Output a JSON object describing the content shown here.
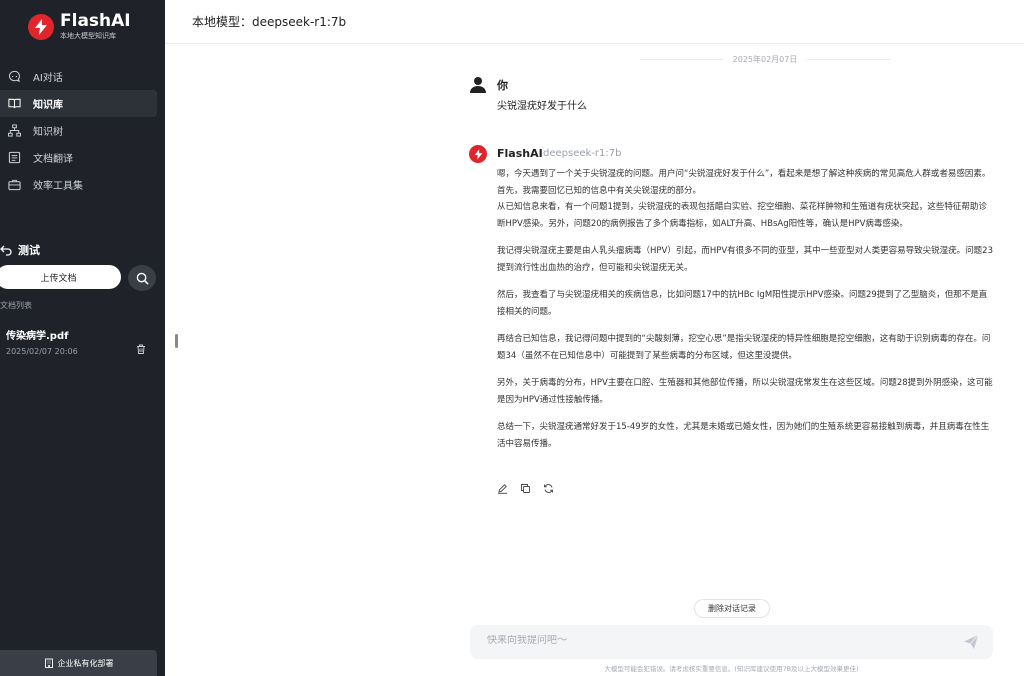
{
  "brand": {
    "name": "FlashAI",
    "subtitle": "本地大模型知识库"
  },
  "nav": [
    {
      "label": "AI对话",
      "icon": "chat-icon",
      "active": false
    },
    {
      "label": "知识库",
      "icon": "book-icon",
      "active": true
    },
    {
      "label": "知识树",
      "icon": "tree-icon",
      "active": false
    },
    {
      "label": "文档翻译",
      "icon": "document-icon",
      "active": false
    },
    {
      "label": "效率工具集",
      "icon": "toolbox-icon",
      "active": false
    }
  ],
  "knowledge_base": {
    "name": "测试",
    "upload_label": "上传文档",
    "doc_list_label": "文档列表",
    "documents": [
      {
        "name": "传染病学.pdf",
        "date": "2025/02/07 20:06"
      }
    ]
  },
  "enterprise_label": "企业私有化部署",
  "header": {
    "label": "本地模型：deepseek-r1:7b"
  },
  "chat": {
    "date": "2025年02月07日",
    "user_name": "你",
    "user_message": "尖锐湿疣好发于什么",
    "ai_name": "FlashAI",
    "ai_model": "deepseek-r1:7b",
    "ai_paragraphs": [
      "嗯，今天遇到了一个关于尖锐湿疣的问题。用户问“尖锐湿疣好发于什么”，看起来是想了解这种疾病的常见高危人群或者易感因素。首先，我需要回忆已知的信息中有关尖锐湿疣的部分。",
      "从已知信息来看，有一个问题1提到，尖锐湿疣的表现包括醋白实验、挖空细胞、菜花样肿物和生殖道有疣状突起，这些特征帮助诊断HPV感染。另外，问题20的病例报告了多个病毒指标，如ALT升高、HBsAg阳性等，确认是HPV病毒感染。",
      "我记得尖锐湿疣主要是由人乳头瘤病毒（HPV）引起，而HPV有很多不同的亚型，其中一些亚型对人类更容易导致尖锐湿疣。问题23提到流行性出血热的治疗，但可能和尖锐湿疣无关。",
      "然后，我查看了与尖锐湿疣相关的疾病信息，比如问题17中的抗HBc IgM阳性提示HPV感染。问题29提到了乙型脑炎，但那不是直接相关的问题。",
      "再结合已知信息，我记得问题中提到的“尖酸刻薄，挖空心思”是指尖锐湿疣的特异性细胞是挖空细胞，这有助于识别病毒的存在。问题34（虽然不在已知信息中）可能提到了某些病毒的分布区域，但这里没提供。",
      "另外，关于病毒的分布，HPV主要在口腔、生殖器和其他部位传播，所以尖锐湿疣常发生在这些区域。问题28提到外阴感染，这可能是因为HPV通过性接触传播。",
      "总结一下，尖锐湿疣通常好发于15-49岁的女性，尤其是未婚或已婚女性，因为她们的生殖系统更容易接触到病毒，并且病毒在性生活中容易传播。"
    ],
    "clear_label": "删除对话记录",
    "input_placeholder": "快来向我提问吧～",
    "disclaimer": "大模型可能会犯错误。请考虑核实重要信息。(知识库建议使用7B及以上大模型效果更佳)"
  },
  "colors": {
    "sidebar_bg": "#1f2329",
    "brand_red": "#e0262d",
    "active_item_bg": "#2d3239"
  }
}
